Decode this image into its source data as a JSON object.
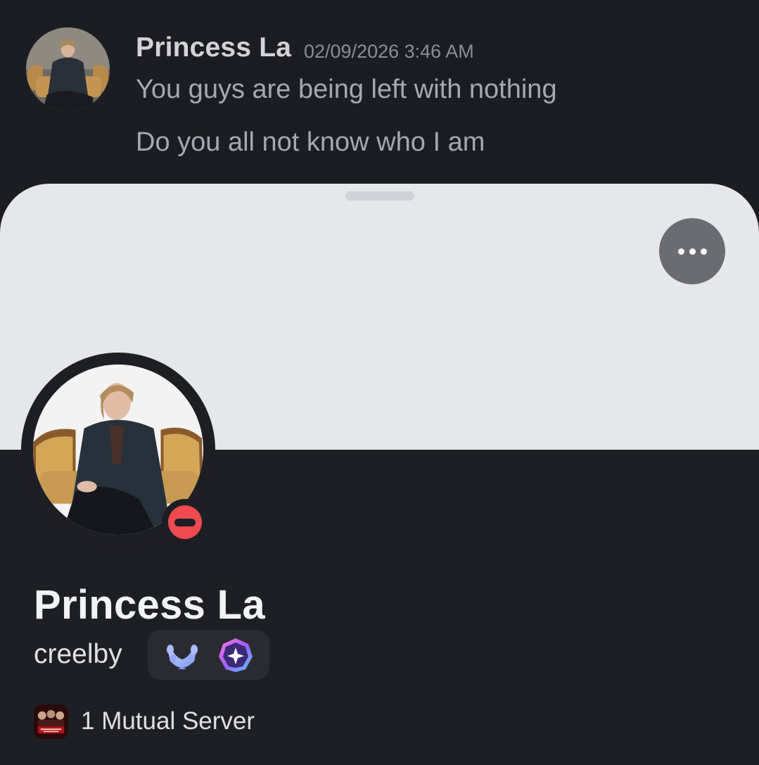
{
  "message": {
    "author": "Princess La",
    "timestamp": "02/09/2026 3:46 AM",
    "lines": [
      "You guys are being left with nothing",
      "Do you all not know who I am"
    ],
    "avatar_icon": "user-photo-avatar"
  },
  "profile": {
    "display_name": "Princess La",
    "username": "creelby",
    "status": "do-not-disturb",
    "status_color": "#ee4a4f",
    "banner_color": "#e6e7eb",
    "more_icon": "ellipsis-icon",
    "badges": [
      {
        "icon": "laurel-wreath-badge-icon"
      },
      {
        "icon": "nitro-gem-badge-icon"
      }
    ],
    "mutual_servers": {
      "label": "1 Mutual Server",
      "server_icon": "stranger-things-server-icon"
    }
  }
}
